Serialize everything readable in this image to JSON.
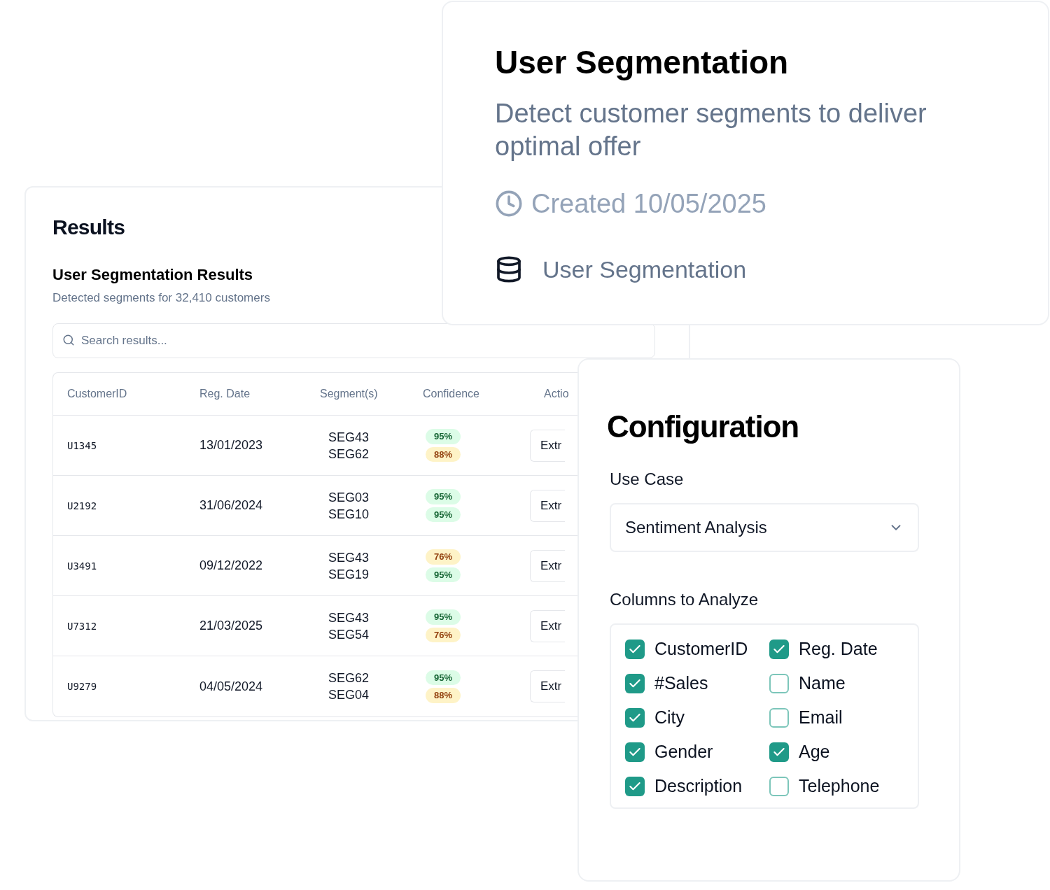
{
  "results": {
    "title": "Results",
    "subtitle": "User Segmentation Results",
    "description": "Detected segments for 32,410 customers",
    "search": {
      "placeholder": "Search results..."
    },
    "table": {
      "columns": [
        "CustomerID",
        "Reg. Date",
        "Segment(s)",
        "Confidence",
        "Actio"
      ],
      "rows": [
        {
          "customer_id": "U1345",
          "reg_date": "13/01/2023",
          "segments": [
            "SEG43",
            "SEG62"
          ],
          "confidence": [
            {
              "value": "95%",
              "kind": "high"
            },
            {
              "value": "88%",
              "kind": "medium"
            }
          ],
          "action": "Extr"
        },
        {
          "customer_id": "U2192",
          "reg_date": "31/06/2024",
          "segments": [
            "SEG03",
            "SEG10"
          ],
          "confidence": [
            {
              "value": "95%",
              "kind": "high"
            },
            {
              "value": "95%",
              "kind": "high"
            }
          ],
          "action": "Extr"
        },
        {
          "customer_id": "U3491",
          "reg_date": "09/12/2022",
          "segments": [
            "SEG43",
            "SEG19"
          ],
          "confidence": [
            {
              "value": "76%",
              "kind": "medium"
            },
            {
              "value": "95%",
              "kind": "high"
            }
          ],
          "action": "Extr"
        },
        {
          "customer_id": "U7312",
          "reg_date": "21/03/2025",
          "segments": [
            "SEG43",
            "SEG54"
          ],
          "confidence": [
            {
              "value": "95%",
              "kind": "high"
            },
            {
              "value": "76%",
              "kind": "medium"
            }
          ],
          "action": "Extr"
        },
        {
          "customer_id": "U9279",
          "reg_date": "04/05/2024",
          "segments": [
            "SEG62",
            "SEG04"
          ],
          "confidence": [
            {
              "value": "95%",
              "kind": "high"
            },
            {
              "value": "88%",
              "kind": "medium"
            }
          ],
          "action": "Extr"
        }
      ]
    }
  },
  "overview": {
    "title": "User Segmentation",
    "description": "Detect customer segments to deliver optimal offer",
    "created": "Created 10/05/2025",
    "dataset": "User Segmentation"
  },
  "configuration": {
    "title": "Configuration",
    "use_case_label": "Use Case",
    "use_case": "Sentiment Analysis",
    "columns_label": "Columns to Analyze",
    "columns": [
      {
        "label": "CustomerID",
        "checked": true
      },
      {
        "label": "Reg. Date",
        "checked": true
      },
      {
        "label": "#Sales",
        "checked": true
      },
      {
        "label": "Name",
        "checked": false
      },
      {
        "label": "City",
        "checked": true
      },
      {
        "label": "Email",
        "checked": false
      },
      {
        "label": "Gender",
        "checked": true
      },
      {
        "label": "Age",
        "checked": true
      },
      {
        "label": "Description",
        "checked": true
      },
      {
        "label": "Telephone",
        "checked": false
      }
    ]
  }
}
